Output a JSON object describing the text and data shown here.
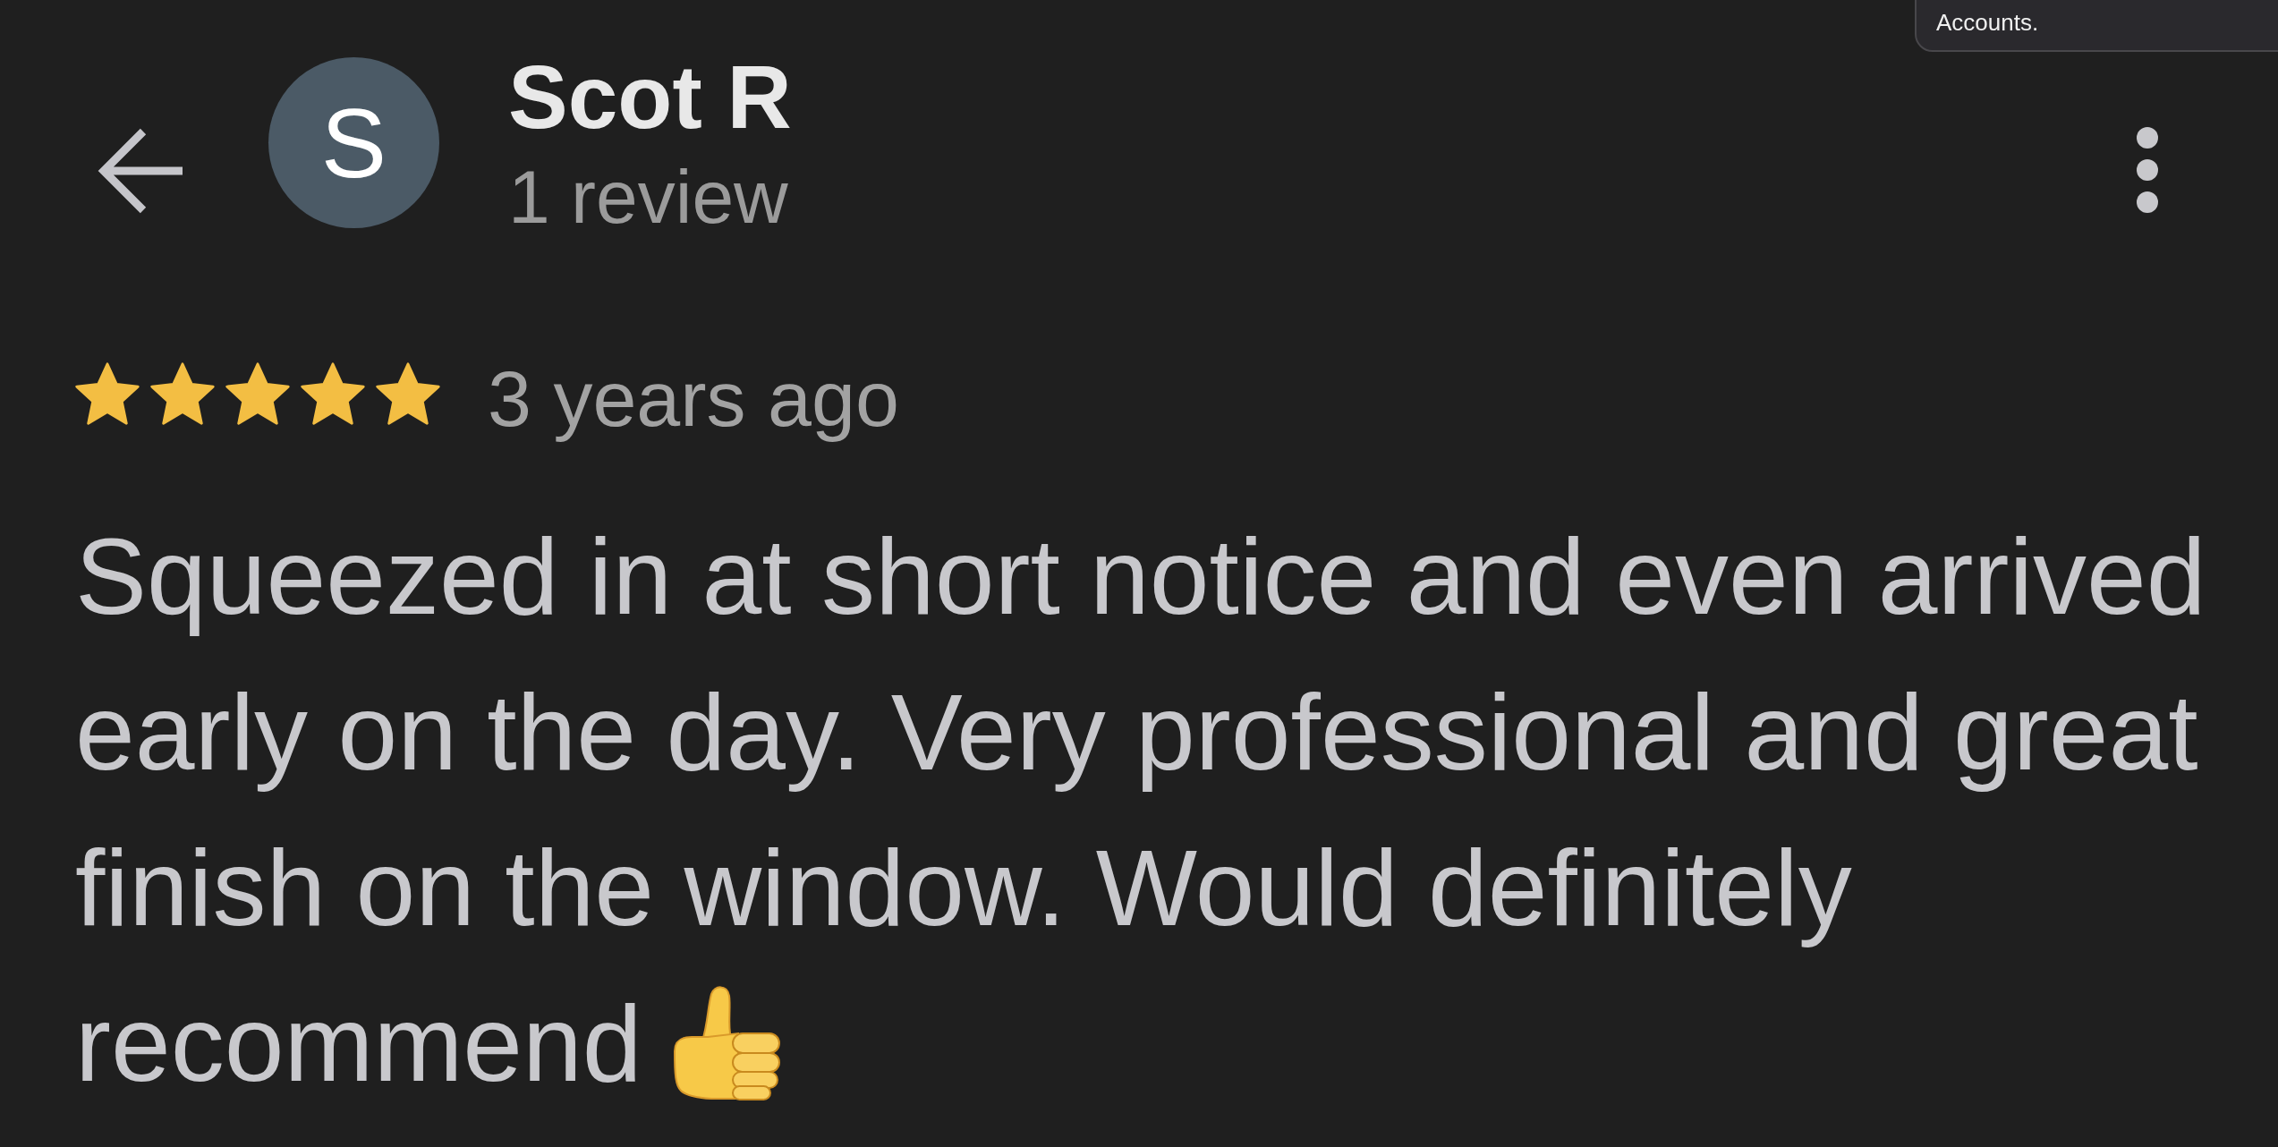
{
  "tooltip": {
    "text": "Accounts."
  },
  "header": {
    "avatar": {
      "initial": "S"
    },
    "name": "Scot R",
    "review_count": "1 review"
  },
  "review": {
    "stars": 5,
    "time": "3 years ago",
    "text": "Squeezed in at short notice and even arrived early on the day. Very professional and great finish on the window. Would definitely recommend"
  }
}
